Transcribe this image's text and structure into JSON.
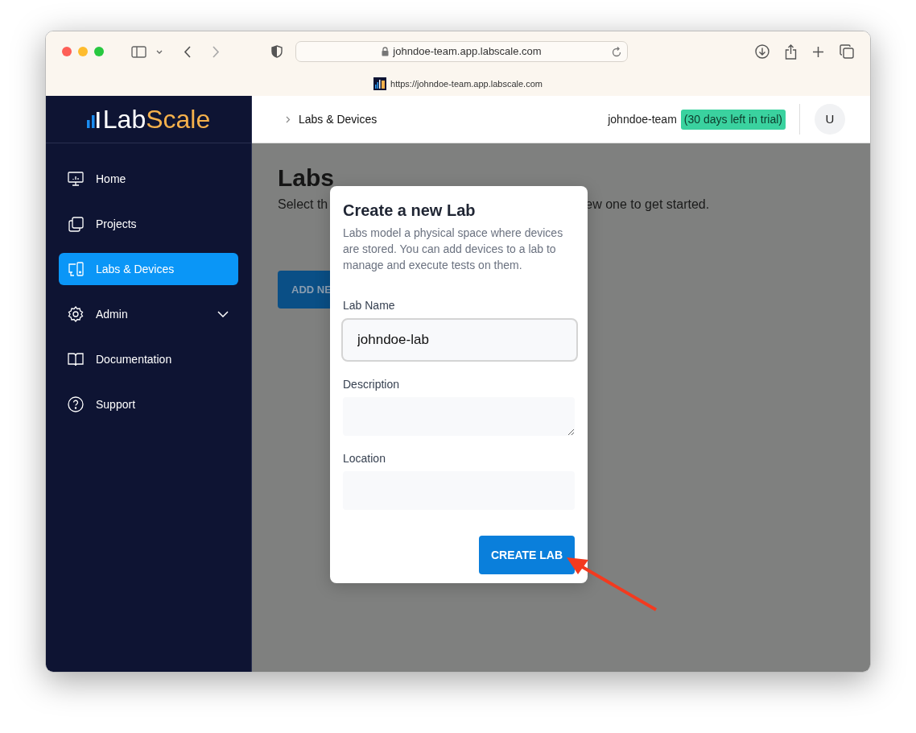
{
  "browser": {
    "address": "johndoe-team.app.labscale.com",
    "tab_url": "https://johndoe-team.app.labscale.com"
  },
  "sidebar": {
    "logo": {
      "part_1": "Lab",
      "part_2": "Scale"
    },
    "items": [
      {
        "label": "Home",
        "selected": false
      },
      {
        "label": "Projects",
        "selected": false
      },
      {
        "label": "Labs & Devices",
        "selected": true
      },
      {
        "label": "Admin",
        "selected": false,
        "expanded": false
      },
      {
        "label": "Documentation",
        "selected": false
      },
      {
        "label": "Support",
        "selected": false
      }
    ]
  },
  "header": {
    "breadcrumb": "Labs & Devices",
    "team": "johndoe-team",
    "trial_badge": "(30 days left in trial)",
    "avatar": "U"
  },
  "page": {
    "title": "Labs",
    "subtitle_start": "Select th",
    "subtitle_end": "ew one to get started.",
    "button": "ADD NE"
  },
  "modal": {
    "title": "Create a new Lab",
    "description": "Labs model a physical space where devices are stored. You can add devices to a lab to manage and execute tests on them.",
    "fields": [
      {
        "label": "Lab Name",
        "kind": "input",
        "value": "johndoe-lab",
        "focused": true
      },
      {
        "label": "Description",
        "kind": "textarea",
        "focused": false
      },
      {
        "label": "Location",
        "kind": "input",
        "focused": false
      }
    ],
    "submit": "CREATE LAB"
  }
}
